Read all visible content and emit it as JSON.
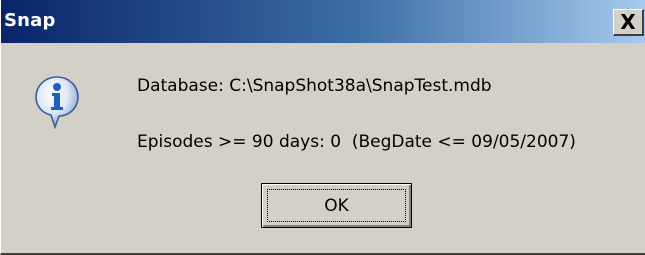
{
  "window": {
    "title": "Snap",
    "close_label": "X"
  },
  "message": {
    "line1": "Database: C:\\SnapShot38a\\SnapTest.mdb",
    "line2": "Episodes >= 90 days: 0  (BegDate <= 09/05/2007)",
    "icon": "information-icon"
  },
  "buttons": {
    "ok_label": "OK"
  },
  "colors": {
    "face": "#d4d0c8",
    "title_start": "#0a246a",
    "title_end": "#a6caf0",
    "icon_blue": "#1f5fbf"
  }
}
